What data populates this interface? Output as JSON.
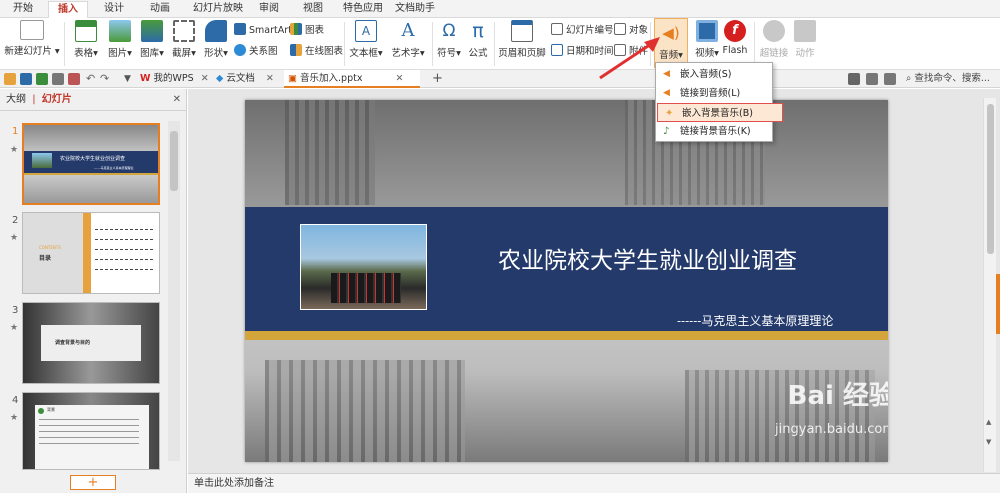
{
  "menu": {
    "tabs": [
      "开始",
      "插入",
      "设计",
      "动画",
      "幻灯片放映",
      "审阅",
      "视图",
      "特色应用",
      "文档助手"
    ],
    "active_tab": "插入"
  },
  "ribbon": {
    "new_slide": "新建幻灯片",
    "table": "表格",
    "picture": "图片",
    "gallery": "图库",
    "screenshot": "截屏",
    "shape": "形状",
    "smartart": "SmartArt",
    "chart": "图表",
    "relation": "关系图",
    "online_chart": "在线图表",
    "textbox": "文本框",
    "wordart": "艺术字",
    "symbol": "符号",
    "formula": "公式",
    "header_footer": "页眉和页脚",
    "slide_number": "幻灯片编号",
    "object": "对象",
    "datetime": "日期和时间",
    "attachment": "附件",
    "audio": "音频",
    "video": "视频",
    "flash": "Flash",
    "hyperlink": "超链接",
    "action": "动作"
  },
  "doc_tabs": {
    "tab1": "我的WPS",
    "tab2": "云文档",
    "tab3": "音乐加入.pptx",
    "search": "查找命令、搜索..."
  },
  "left_pane": {
    "outline_tab": "大纲",
    "slides_tab": "幻灯片",
    "slide_numbers": [
      "1",
      "2",
      "3",
      "4"
    ],
    "thumb1_title": "农业院校大学生就业创业调查",
    "thumb1_sub": "------马克思主义基本原理理论",
    "thumb2_contents": "CONTENTS",
    "thumb2_toc": "目录",
    "thumb3_title": "调查背景与目的",
    "thumb4_title": "背景",
    "add_button": "+"
  },
  "slide": {
    "title": "农业院校大学生就业创业调查",
    "subtitle": "------马克思主义基本原理理论"
  },
  "notes": {
    "placeholder": "单击此处添加备注"
  },
  "audio_menu": {
    "items": [
      "嵌入音频(S)",
      "链接到音频(L)",
      "嵌入背景音乐(B)",
      "链接背景音乐(K)"
    ],
    "highlighted_index": 2
  },
  "watermark": {
    "logo": "Bai 经验",
    "url": "jingyan.baidu.com"
  },
  "colors": {
    "accent": "#c0392b",
    "slide_band": "#233a6b",
    "gold_bar": "#d4a53a",
    "highlight_box": "#e05050",
    "arrow": "#e03030"
  }
}
